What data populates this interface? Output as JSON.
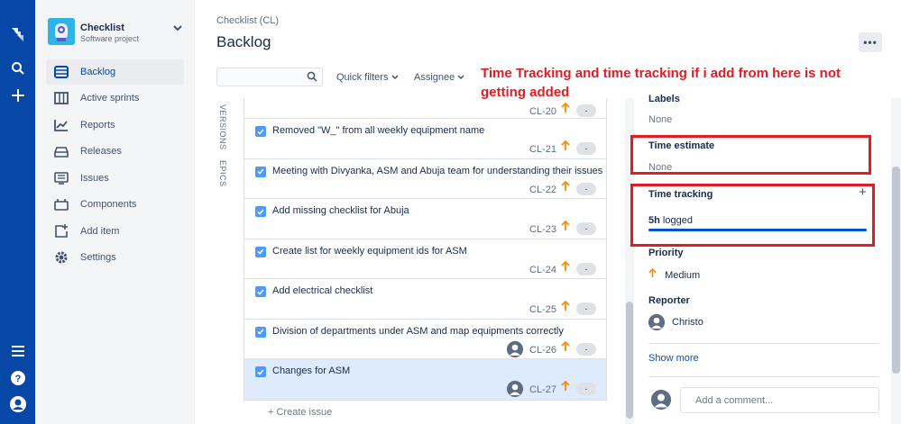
{
  "colors": {
    "nav": "#0747a6",
    "accent": "#0052cc",
    "annotation": "#e31b23",
    "priority": "#ff8b00"
  },
  "global_nav": {
    "icons": [
      "jira-logo-icon",
      "search-icon",
      "create-plus-icon",
      "menu-icon",
      "help-icon",
      "profile-icon"
    ]
  },
  "project": {
    "name": "Checklist",
    "type": "Software project"
  },
  "sidebar": {
    "items": [
      {
        "label": "Backlog",
        "icon": "backlog-icon",
        "active": true
      },
      {
        "label": "Active sprints",
        "icon": "board-icon"
      },
      {
        "label": "Reports",
        "icon": "reports-icon"
      },
      {
        "label": "Releases",
        "icon": "releases-icon"
      },
      {
        "label": "Issues",
        "icon": "issues-icon"
      },
      {
        "label": "Components",
        "icon": "components-icon"
      },
      {
        "label": "Add item",
        "icon": "add-item-icon"
      },
      {
        "label": "Settings",
        "icon": "gear-icon"
      }
    ]
  },
  "header": {
    "breadcrumb": "Checklist (CL)",
    "title": "Backlog",
    "more": "•••"
  },
  "toolbar": {
    "search_placeholder": "",
    "quick_filters": "Quick filters",
    "assignee": "Assignee"
  },
  "annotation": "Time Tracking and time tracking if i add from here is not getting added",
  "vertical_tabs": {
    "versions": "VERSIONS",
    "epics": "EPICS"
  },
  "issues": [
    {
      "summary": "",
      "key": "CL-20",
      "estimate": "-",
      "assignee": false,
      "selected": false
    },
    {
      "summary": "Removed \"W_\" from all weekly equipment name",
      "key": "CL-21",
      "estimate": "-",
      "assignee": false,
      "selected": false
    },
    {
      "summary": "Meeting with Divyanka, ASM and Abuja team for understanding their issues",
      "key": "CL-22",
      "estimate": "-",
      "assignee": false,
      "selected": false
    },
    {
      "summary": "Add missing checklist for Abuja",
      "key": "CL-23",
      "estimate": "-",
      "assignee": false,
      "selected": false
    },
    {
      "summary": "Create list for weekly equipment ids for ASM",
      "key": "CL-24",
      "estimate": "-",
      "assignee": false,
      "selected": false
    },
    {
      "summary": "Add electrical checklist",
      "key": "CL-25",
      "estimate": "-",
      "assignee": false,
      "selected": false
    },
    {
      "summary": "Division of departments under ASM and map equipments correctly",
      "key": "CL-26",
      "estimate": "-",
      "assignee": true,
      "selected": false
    },
    {
      "summary": "Changes for ASM",
      "key": "CL-27",
      "estimate": "-",
      "assignee": true,
      "selected": true
    }
  ],
  "create_issue": "+ Create issue",
  "detail": {
    "labels_label": "Labels",
    "labels_value": "None",
    "time_estimate_label": "Time estimate",
    "time_estimate_value": "None",
    "time_tracking_label": "Time tracking",
    "time_tracking_plus": "+",
    "time_logged_hours": "5h",
    "time_logged_suffix": " logged",
    "time_logged_fraction": 1.0,
    "priority_label": "Priority",
    "priority_value": "Medium",
    "reporter_label": "Reporter",
    "reporter_value": "Christo",
    "show_more": "Show more",
    "comment_placeholder": "Add a comment..."
  }
}
